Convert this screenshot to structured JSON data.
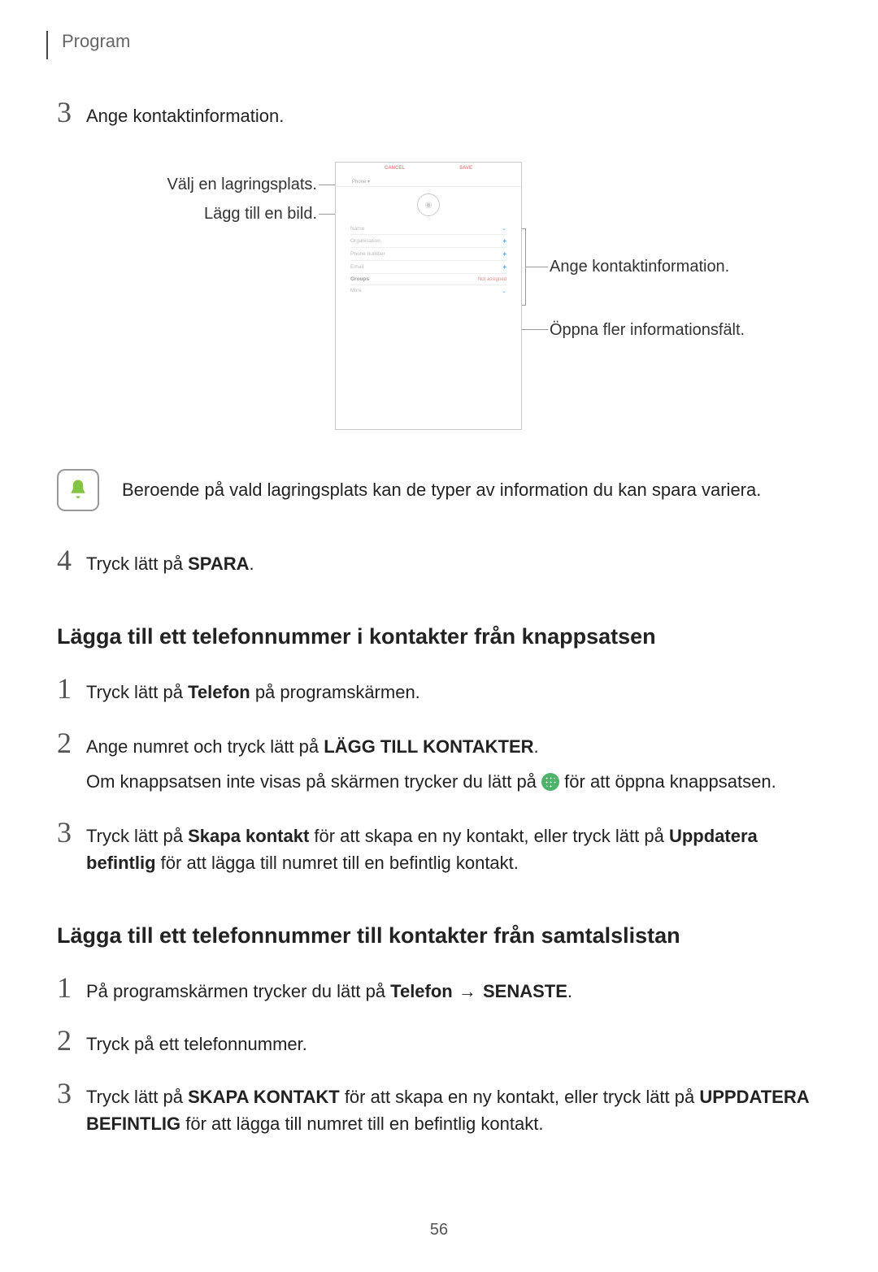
{
  "section": "Program",
  "step3_top": {
    "num": "3",
    "text": "Ange kontaktinformation."
  },
  "figure": {
    "left_labels": {
      "storage": "Välj en lagringsplats.",
      "image": "Lägg till en bild."
    },
    "right_labels": {
      "info": "Ange kontaktinformation.",
      "more": "Öppna fler informationsfält."
    },
    "mock": {
      "cancel": "CANCEL",
      "save": "SAVE",
      "storage_label": "Phone ▾",
      "fields": {
        "name": "Name",
        "organisation": "Organisation",
        "phone": "Phone number",
        "email": "Email",
        "groups": "Groups",
        "not_assigned": "Not assigned",
        "more": "More"
      }
    }
  },
  "note": "Beroende på vald lagringsplats kan de typer av information du kan spara variera.",
  "step4": {
    "num": "4",
    "pre": "Tryck lätt på ",
    "spara": "SPARA",
    "post": "."
  },
  "heading_keypad": "Lägga till ett telefonnummer i kontakter från knappsatsen",
  "kp1": {
    "num": "1",
    "pre": "Tryck lätt på ",
    "bold": "Telefon",
    "post": " på programskärmen."
  },
  "kp2": {
    "num": "2",
    "pre": "Ange numret och tryck lätt på ",
    "bold": "LÄGG TILL KONTAKTER",
    "post": ".",
    "sub_pre": "Om knappsatsen inte visas på skärmen trycker du lätt på ",
    "sub_post": " för att öppna knappsatsen."
  },
  "kp3": {
    "num": "3",
    "pre": "Tryck lätt på ",
    "bold1": "Skapa kontakt",
    "mid": " för att skapa en ny kontakt, eller tryck lätt på ",
    "bold2": "Uppdatera befintlig",
    "post": " för att lägga till numret till en befintlig kontakt."
  },
  "heading_calllog": "Lägga till ett telefonnummer till kontakter från samtalslistan",
  "cl1": {
    "num": "1",
    "pre": "På programskärmen trycker du lätt på ",
    "bold": "Telefon",
    "arrow": " → ",
    "bold2": "SENASTE",
    "post": "."
  },
  "cl2": {
    "num": "2",
    "text": "Tryck på ett telefonnummer."
  },
  "cl3": {
    "num": "3",
    "pre": "Tryck lätt på ",
    "bold1": "SKAPA KONTAKT",
    "mid": " för att skapa en ny kontakt, eller tryck lätt på ",
    "bold2": "UPPDATERA BEFINTLIG",
    "post": " för att lägga till numret till en befintlig kontakt."
  },
  "page_number": "56"
}
